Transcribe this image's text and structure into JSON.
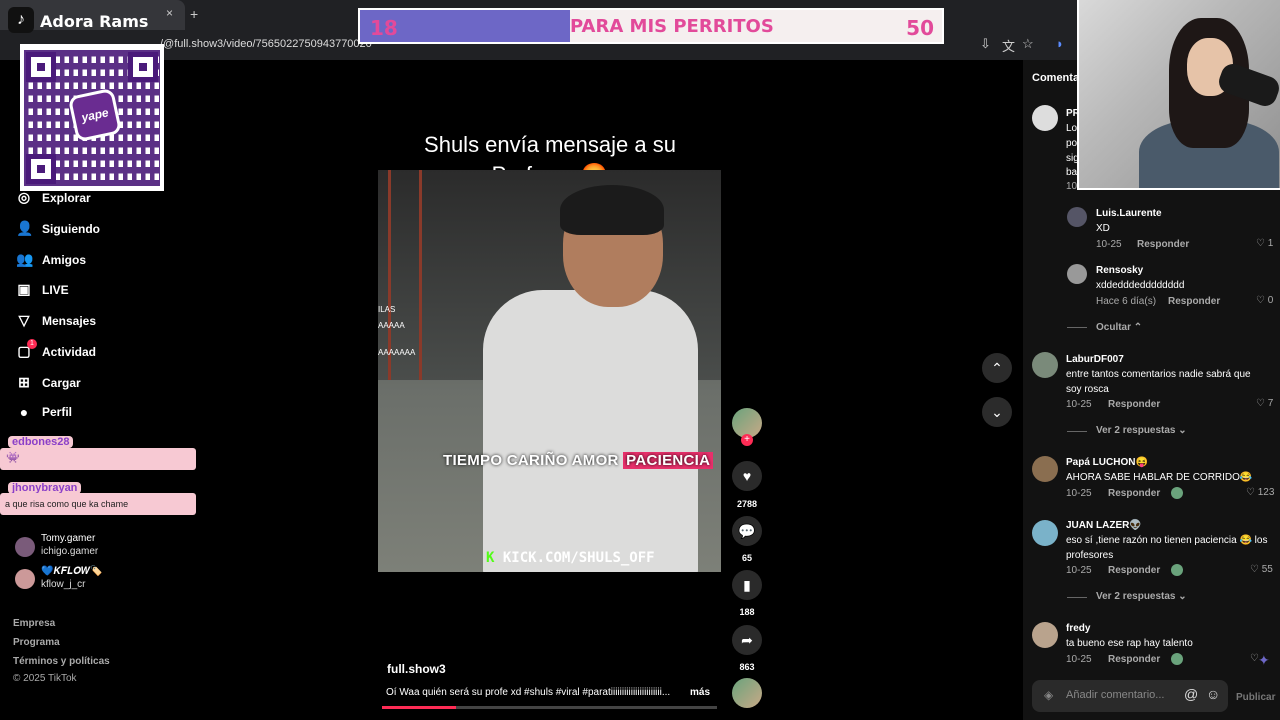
{
  "browser": {
    "tab_title": "Adora Rams",
    "tab_icon": "♪",
    "close_glyph": "×",
    "new_tab_glyph": "+",
    "url": "/@full.show3/video/7565022750943770020"
  },
  "goal": {
    "current": "18",
    "label": "PARA MIS PERRITOS",
    "target": "50",
    "progress": 0.36
  },
  "qr": {
    "logo_text": "yape"
  },
  "sidebar": {
    "items": [
      {
        "label": "Explorar",
        "icon": "compass-icon",
        "glyph": "◎"
      },
      {
        "label": "Siguiendo",
        "icon": "following-icon",
        "glyph": "👤"
      },
      {
        "label": "Amigos",
        "icon": "friends-icon",
        "glyph": "👥"
      },
      {
        "label": "LIVE",
        "icon": "live-icon",
        "glyph": "▣"
      },
      {
        "label": "Mensajes",
        "icon": "messages-icon",
        "glyph": "▽"
      },
      {
        "label": "Actividad",
        "icon": "activity-icon",
        "glyph": "▢"
      },
      {
        "label": "Cargar",
        "icon": "upload-icon",
        "glyph": "⊞"
      },
      {
        "label": "Perfil",
        "icon": "profile-icon",
        "glyph": "●"
      }
    ],
    "activity_badge": "1",
    "chat": [
      {
        "user": "edbones28",
        "message": ""
      },
      {
        "user": "jhonybrayan",
        "message": "a que risa como que ka chame"
      }
    ],
    "following": [
      {
        "name": "Tomy.gamer",
        "sub": "ichigo.gamer"
      },
      {
        "name": "💙𝑲𝑭𝑳𝑶𝑾🏷️",
        "sub": "kflow_j_cr"
      }
    ],
    "footer": [
      "Empresa",
      "Programa",
      "Términos y políticas",
      "© 2025 TikTok"
    ]
  },
  "video": {
    "title_line1": "Shuls envía mensaje a su",
    "title_line2": "Profesor 🤬",
    "caption_plain": "TIEMPO CARIÑO AMOR ",
    "caption_highlight": "PACIENCIA",
    "kick_k": "K",
    "kick_text": "KICK.COM/SHULS_OFF",
    "side_texts": [
      "ILAS",
      "AAAAA",
      "AAAAAAA"
    ],
    "author": "full.show3",
    "description": "Oí Waa quién será su profe xd #shuls #viral #paratiiiiiiiiiiiiiiiiiiiiiii...",
    "more_label": "más",
    "progress": 0.22
  },
  "actions": {
    "likes": "2788",
    "comments": "65",
    "saves": "188",
    "shares": "863"
  },
  "comments": {
    "tab_label": "Comentar",
    "list": [
      {
        "user": "Luis.Laurente",
        "text": "XD",
        "date": "10-25",
        "likes": "1",
        "reply": "Responder"
      },
      {
        "user": "Rensosky",
        "text": "xddedddedddddddd",
        "date": "Hace 6 día(s)",
        "likes": "0",
        "reply": "Responder"
      },
      {
        "user": "LaburDF007",
        "text": "entre tantos comentarios nadie sabrá que soy rosca",
        "date": "10-25",
        "likes": "7",
        "reply": "Responder"
      },
      {
        "user": "Papá LUCHON😝",
        "text": "AHORA SABE HABLAR DE CORRIDO😂",
        "date": "10-25",
        "likes": "123",
        "reply": "Responder"
      },
      {
        "user": "JUAN LAZER👽",
        "text": "eso sí ,tiene razón no tienen paciencia 😂 los profesores",
        "date": "10-25",
        "likes": "55",
        "reply": "Responder"
      },
      {
        "user": "fredy",
        "text": "ta bueno ese rap hay talento",
        "date": "10-25",
        "likes": "",
        "reply": "Responder"
      }
    ],
    "hide_label": "Ocultar ⌃",
    "view_replies_1": "Ver 2 respuestas ⌄",
    "view_replies_2": "Ver 2 respuestas ⌄",
    "top_partial": [
      "PR",
      "Lo",
      "po",
      "sig",
      "ba",
      "10"
    ],
    "input_placeholder": "Añadir comentario...",
    "publish_label": "Publicar"
  }
}
